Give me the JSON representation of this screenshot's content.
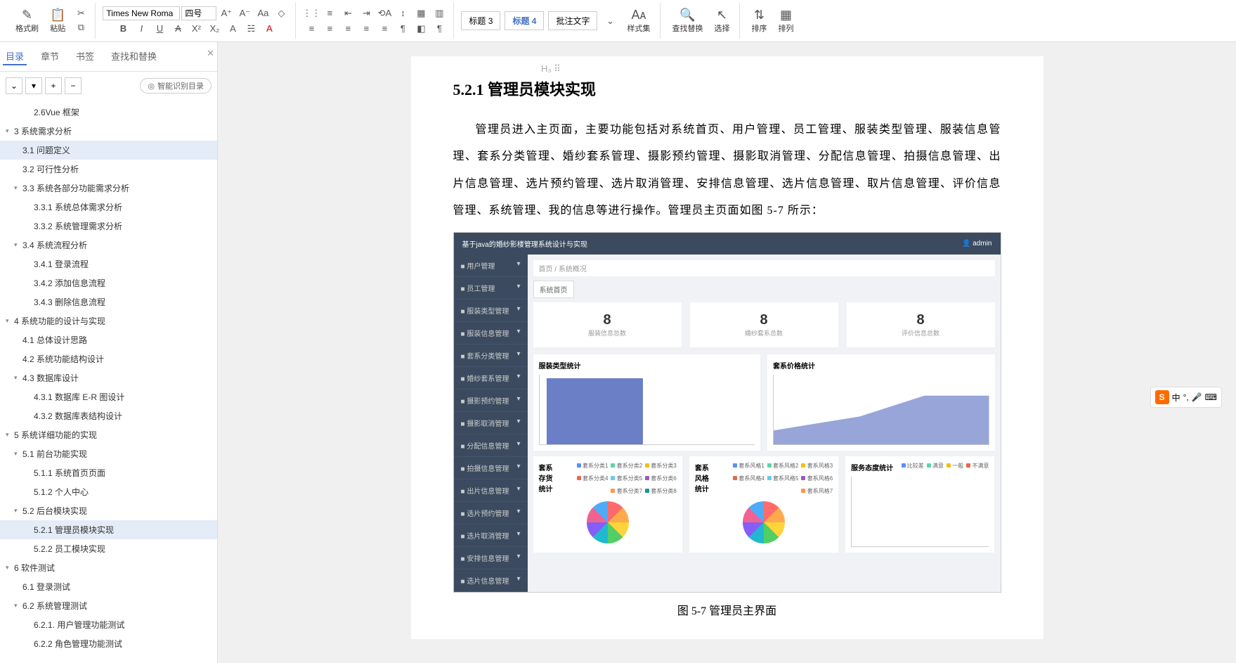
{
  "toolbar": {
    "format_painter": "格式刷",
    "paste": "粘贴",
    "font_name": "Times New Roma",
    "font_size": "四号",
    "styles": "样式集",
    "find_replace": "查找替换",
    "select": "选择",
    "sort": "排序",
    "arrange": "排列",
    "style_heading3": "标题 3",
    "style_heading4": "标题 4",
    "style_comment": "批注文字"
  },
  "sidebar": {
    "tabs": {
      "outline": "目录",
      "chapter": "章节",
      "bookmark": "书签",
      "findreplace": "查找和替换"
    },
    "smart_outline": "智能识别目录",
    "items": [
      {
        "level": 3,
        "label": "2.6Vue 框架"
      },
      {
        "level": 1,
        "label": "3 系统需求分析",
        "caret": "▾"
      },
      {
        "level": 2,
        "label": "3.1 问题定义",
        "active": true
      },
      {
        "level": 2,
        "label": "3.2 可行性分析"
      },
      {
        "level": 2,
        "label": "3.3 系统各部分功能需求分析",
        "caret": "▾"
      },
      {
        "level": 3,
        "label": "3.3.1 系统总体需求分析"
      },
      {
        "level": 3,
        "label": "3.3.2 系统管理需求分析"
      },
      {
        "level": 2,
        "label": "3.4 系统流程分析",
        "caret": "▾"
      },
      {
        "level": 3,
        "label": "3.4.1 登录流程"
      },
      {
        "level": 3,
        "label": "3.4.2 添加信息流程"
      },
      {
        "level": 3,
        "label": "3.4.3 删除信息流程"
      },
      {
        "level": 1,
        "label": "4 系统功能的设计与实现",
        "caret": "▾"
      },
      {
        "level": 2,
        "label": "4.1 总体设计思路"
      },
      {
        "level": 2,
        "label": "4.2 系统功能结构设计"
      },
      {
        "level": 2,
        "label": "4.3 数据库设计",
        "caret": "▾"
      },
      {
        "level": 3,
        "label": "4.3.1 数据库 E-R 图设计"
      },
      {
        "level": 3,
        "label": "4.3.2 数据库表结构设计"
      },
      {
        "level": 1,
        "label": "5 系统详细功能的实现",
        "caret": "▾"
      },
      {
        "level": 2,
        "label": "5.1 前台功能实现",
        "caret": "▾"
      },
      {
        "level": 3,
        "label": "5.1.1 系统首页页面"
      },
      {
        "level": 3,
        "label": "5.1.2 个人中心"
      },
      {
        "level": 2,
        "label": "5.2 后台模块实现",
        "caret": "▾"
      },
      {
        "level": 3,
        "label": "5.2.1 管理员模块实现",
        "active": true
      },
      {
        "level": 3,
        "label": "5.2.2 员工模块实现"
      },
      {
        "level": 1,
        "label": "6 软件测试",
        "caret": "▾"
      },
      {
        "level": 2,
        "label": "6.1 登录测试"
      },
      {
        "level": 2,
        "label": "6.2 系统管理测试",
        "caret": "▾"
      },
      {
        "level": 3,
        "label": "6.2.1. 用户管理功能测试"
      },
      {
        "level": 3,
        "label": "6.2.2 角色管理功能测试"
      }
    ]
  },
  "doc": {
    "heading_marker": "H₃ ⠿",
    "title": "5.2.1 管理员模块实现",
    "paragraph": "管理员进入主页面，主要功能包括对系统首页、用户管理、员工管理、服装类型管理、服装信息管理、套系分类管理、婚纱套系管理、摄影预约管理、摄影取消管理、分配信息管理、拍摄信息管理、出片信息管理、选片预约管理、选片取消管理、安排信息管理、选片信息管理、取片信息管理、评价信息管理、系统管理、我的信息等进行操作。管理员主页面如图 5-7 所示：",
    "caption": "图 5-7 管理员主界面"
  },
  "embed": {
    "app_title": "基于java的婚纱影楼管理系统设计与实现",
    "admin": "admin",
    "nav": [
      "用户管理",
      "员工管理",
      "服装类型管理",
      "服装信息管理",
      "套系分类管理",
      "婚纱套系管理",
      "摄影预约管理",
      "摄影取消管理",
      "分配信息管理",
      "拍摄信息管理",
      "出片信息管理",
      "选片预约管理",
      "选片取消管理",
      "安排信息管理",
      "选片信息管理"
    ],
    "crumb_home": "首页",
    "crumb_sep": "/",
    "crumb_page": "系统概况",
    "subtab": "系统首页",
    "stats": [
      {
        "num": "8",
        "label": "服装信息总数"
      },
      {
        "num": "8",
        "label": "婚纱套系总数"
      },
      {
        "num": "8",
        "label": "评价信息总数"
      }
    ],
    "chart1_title": "服装类型统计",
    "chart2_title": "套系价格统计",
    "chart3_title": "套系存货统计",
    "chart4_title": "套系风格统计",
    "chart5_title": "服务态度统计",
    "legend3": [
      "套系分类1",
      "套系分类2",
      "套系分类3",
      "套系分类4",
      "套系分类5",
      "套系分类6",
      "套系分类7",
      "套系分类8"
    ],
    "legend4": [
      "套系风格1",
      "套系风格2",
      "套系风格3",
      "套系风格4",
      "套系风格5",
      "套系风格6",
      "套系风格7"
    ],
    "legend5": [
      "比较差",
      "满意",
      "一般",
      "不满意"
    ]
  },
  "ime": {
    "lang": "中",
    "mic": "🎤"
  }
}
